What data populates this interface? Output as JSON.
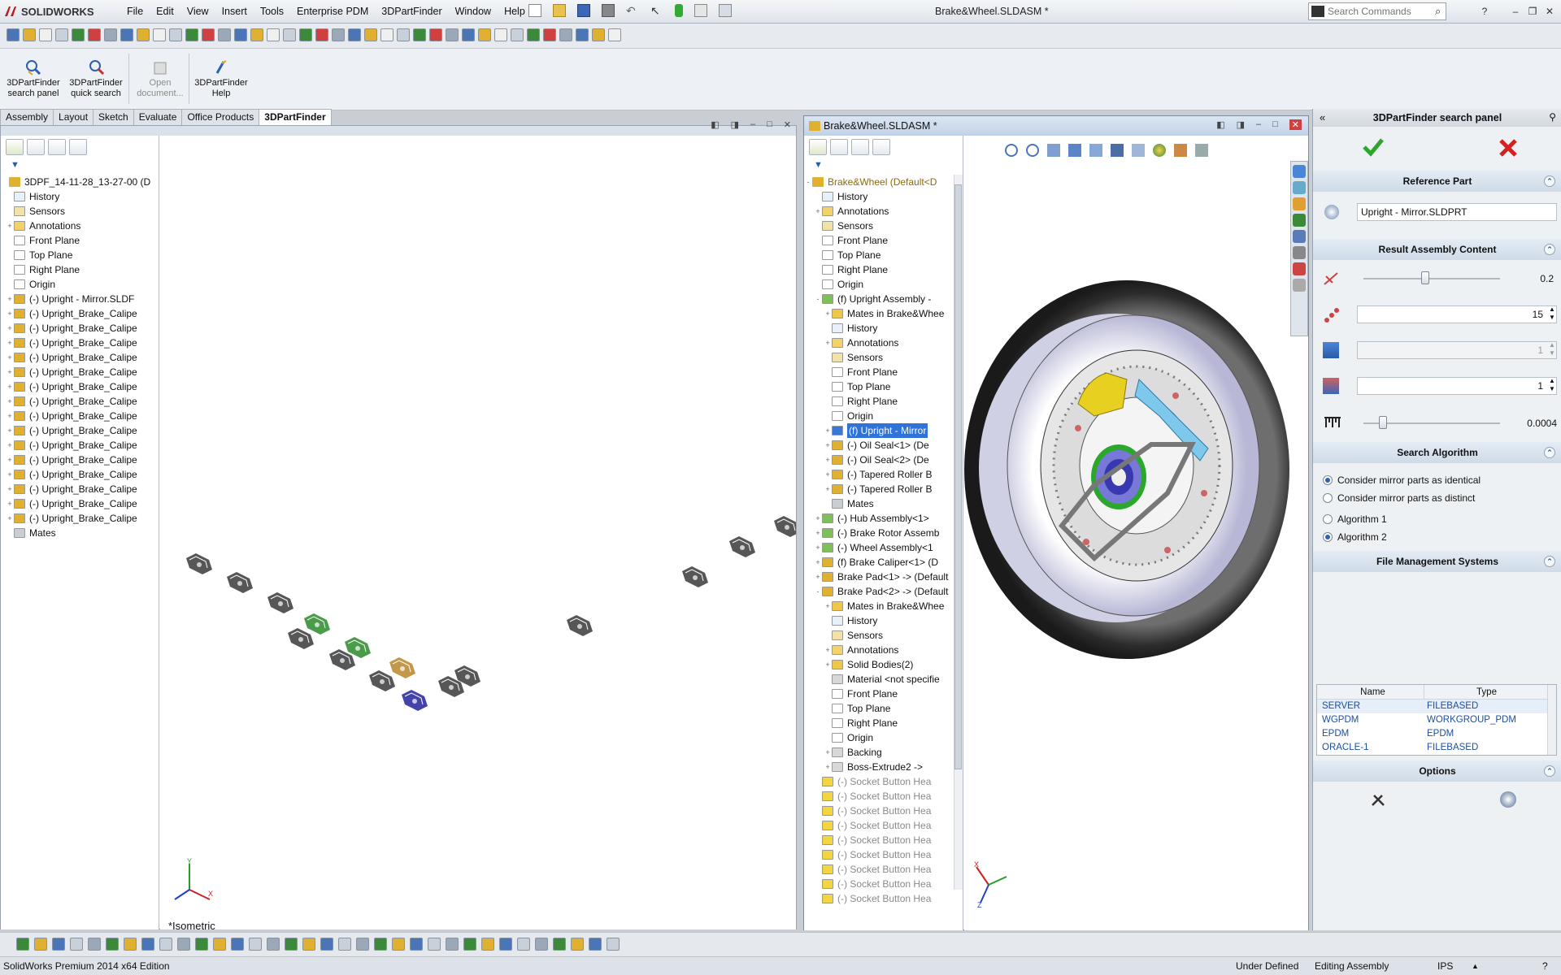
{
  "app": {
    "brand": "SOLIDWORKS",
    "document_title": "Brake&Wheel.SLDASM *",
    "menus": [
      "File",
      "Edit",
      "View",
      "Insert",
      "Tools",
      "Enterprise PDM",
      "3DPartFinder",
      "Window",
      "Help"
    ],
    "search_placeholder": "Search Commands"
  },
  "ribbon": {
    "buttons": [
      {
        "label": "3DPartFinder search panel",
        "enabled": true
      },
      {
        "label": "3DPartFinder quick search",
        "enabled": true
      },
      {
        "label": "Open document...",
        "enabled": false
      },
      {
        "label": "3DPartFinder Help",
        "enabled": true
      }
    ]
  },
  "command_tabs": [
    "Assembly",
    "Layout",
    "Sketch",
    "Evaluate",
    "Office Products",
    "3DPartFinder"
  ],
  "command_tabs_active": "3DPartFinder",
  "left_window": {
    "tree_root": "3DPF_14-11-28_13-27-00  (D",
    "tree_items": [
      {
        "label": "History",
        "type": "history"
      },
      {
        "label": "Sensors",
        "type": "sensor"
      },
      {
        "label": "Annotations",
        "type": "annot",
        "exp": "+"
      },
      {
        "label": "Front Plane",
        "type": "plane"
      },
      {
        "label": "Top Plane",
        "type": "plane"
      },
      {
        "label": "Right Plane",
        "type": "plane"
      },
      {
        "label": "Origin",
        "type": "origin"
      },
      {
        "label": "(-) Upright - Mirror.SLDF",
        "type": "part",
        "exp": "+"
      },
      {
        "label": "(-) Upright_Brake_Calipe",
        "type": "part",
        "exp": "+"
      },
      {
        "label": "(-) Upright_Brake_Calipe",
        "type": "part",
        "exp": "+"
      },
      {
        "label": "(-) Upright_Brake_Calipe",
        "type": "part",
        "exp": "+"
      },
      {
        "label": "(-) Upright_Brake_Calipe",
        "type": "part",
        "exp": "+"
      },
      {
        "label": "(-) Upright_Brake_Calipe",
        "type": "part",
        "exp": "+"
      },
      {
        "label": "(-) Upright_Brake_Calipe",
        "type": "part",
        "exp": "+"
      },
      {
        "label": "(-) Upright_Brake_Calipe",
        "type": "part",
        "exp": "+"
      },
      {
        "label": "(-) Upright_Brake_Calipe",
        "type": "part",
        "exp": "+"
      },
      {
        "label": "(-) Upright_Brake_Calipe",
        "type": "part",
        "exp": "+"
      },
      {
        "label": "(-) Upright_Brake_Calipe",
        "type": "part",
        "exp": "+"
      },
      {
        "label": "(-) Upright_Brake_Calipe",
        "type": "part",
        "exp": "+"
      },
      {
        "label": "(-) Upright_Brake_Calipe",
        "type": "part",
        "exp": "+"
      },
      {
        "label": "(-) Upright_Brake_Calipe",
        "type": "part",
        "exp": "+"
      },
      {
        "label": "(-) Upright_Brake_Calipe",
        "type": "part",
        "exp": "+"
      },
      {
        "label": "(-) Upright_Brake_Calipe",
        "type": "part",
        "exp": "+"
      },
      {
        "label": "Mates",
        "type": "mates"
      }
    ],
    "view_name": "*Isometric"
  },
  "right_window": {
    "title": "Brake&Wheel.SLDASM *",
    "tree_root": "Brake&Wheel  (Default<D",
    "tree_items": [
      {
        "label": "History",
        "type": "history",
        "indent": 1
      },
      {
        "label": "Annotations",
        "type": "annot",
        "indent": 1,
        "exp": "+"
      },
      {
        "label": "Sensors",
        "type": "sensor",
        "indent": 1
      },
      {
        "label": "Front Plane",
        "type": "plane",
        "indent": 1
      },
      {
        "label": "Top Plane",
        "type": "plane",
        "indent": 1
      },
      {
        "label": "Right Plane",
        "type": "plane",
        "indent": 1
      },
      {
        "label": "Origin",
        "type": "origin",
        "indent": 1
      },
      {
        "label": "(f) Upright Assembly -",
        "type": "asm",
        "indent": 1,
        "exp": "-"
      },
      {
        "label": "Mates in Brake&Whee",
        "type": "folder",
        "indent": 2,
        "exp": "+"
      },
      {
        "label": "History",
        "type": "history",
        "indent": 2
      },
      {
        "label": "Annotations",
        "type": "annot",
        "indent": 2,
        "exp": "+"
      },
      {
        "label": "Sensors",
        "type": "sensor",
        "indent": 2
      },
      {
        "label": "Front Plane",
        "type": "plane",
        "indent": 2
      },
      {
        "label": "Top Plane",
        "type": "plane",
        "indent": 2
      },
      {
        "label": "Right Plane",
        "type": "plane",
        "indent": 2
      },
      {
        "label": "Origin",
        "type": "origin",
        "indent": 2
      },
      {
        "label": "(f) Upright - Mirror",
        "type": "partsel",
        "indent": 2,
        "exp": "+",
        "selected": true
      },
      {
        "label": "(-) Oil Seal<1> (De",
        "type": "part",
        "indent": 2,
        "exp": "+"
      },
      {
        "label": "(-) Oil Seal<2> (De",
        "type": "part",
        "indent": 2,
        "exp": "+"
      },
      {
        "label": "(-) Tapered Roller B",
        "type": "part",
        "indent": 2,
        "exp": "+"
      },
      {
        "label": "(-) Tapered Roller B",
        "type": "part",
        "indent": 2,
        "exp": "+"
      },
      {
        "label": "Mates",
        "type": "mates",
        "indent": 2
      },
      {
        "label": "(-) Hub Assembly<1>",
        "type": "asm",
        "indent": 1,
        "exp": "+"
      },
      {
        "label": "(-) Brake Rotor Assemb",
        "type": "asm",
        "indent": 1,
        "exp": "+"
      },
      {
        "label": "(-) Wheel Assembly<1",
        "type": "asm",
        "indent": 1,
        "exp": "+"
      },
      {
        "label": "(f) Brake Caliper<1> (D",
        "type": "part",
        "indent": 1,
        "exp": "+"
      },
      {
        "label": "Brake Pad<1> -> (Default",
        "type": "part",
        "indent": 1,
        "exp": "+"
      },
      {
        "label": "Brake Pad<2> -> (Default",
        "type": "part",
        "indent": 1,
        "exp": "-"
      },
      {
        "label": "Mates in Brake&Whee",
        "type": "folder",
        "indent": 2,
        "exp": "+"
      },
      {
        "label": "History",
        "type": "history",
        "indent": 2
      },
      {
        "label": "Sensors",
        "type": "sensor",
        "indent": 2
      },
      {
        "label": "Annotations",
        "type": "annot",
        "indent": 2,
        "exp": "+"
      },
      {
        "label": "Solid Bodies(2)",
        "type": "folder",
        "indent": 2,
        "exp": "+"
      },
      {
        "label": "Material <not specifie",
        "type": "material",
        "indent": 2
      },
      {
        "label": "Front Plane",
        "type": "plane",
        "indent": 2
      },
      {
        "label": "Top Plane",
        "type": "plane",
        "indent": 2
      },
      {
        "label": "Right Plane",
        "type": "plane",
        "indent": 2
      },
      {
        "label": "Origin",
        "type": "origin",
        "indent": 2
      },
      {
        "label": "Backing",
        "type": "feature",
        "indent": 2,
        "exp": "+"
      },
      {
        "label": "Boss-Extrude2 ->",
        "type": "feature",
        "indent": 2,
        "exp": "+"
      },
      {
        "label": "(-) Socket Button Hea",
        "type": "warn",
        "indent": 1,
        "gray": true
      },
      {
        "label": "(-) Socket Button Hea",
        "type": "warn",
        "indent": 1,
        "gray": true
      },
      {
        "label": "(-) Socket Button Hea",
        "type": "warn",
        "indent": 1,
        "gray": true
      },
      {
        "label": "(-) Socket Button Hea",
        "type": "warn",
        "indent": 1,
        "gray": true
      },
      {
        "label": "(-) Socket Button Hea",
        "type": "warn",
        "indent": 1,
        "gray": true
      },
      {
        "label": "(-) Socket Button Hea",
        "type": "warn",
        "indent": 1,
        "gray": true
      },
      {
        "label": "(-) Socket Button Hea",
        "type": "warn",
        "indent": 1,
        "gray": true
      },
      {
        "label": "(-) Socket Button Hea",
        "type": "warn",
        "indent": 1,
        "gray": true
      },
      {
        "label": "(-) Socket Button Hea",
        "type": "warn",
        "indent": 1,
        "gray": true
      }
    ]
  },
  "panel": {
    "title": "3DPartFinder search panel",
    "reference_part_header": "Reference Part",
    "reference_part_value": "Upright - Mirror.SLDPRT",
    "result_header": "Result Assembly Content",
    "slider1_value": "0.2",
    "slider1_fraction": 0.45,
    "count_value": "15",
    "spin2_value": "1",
    "spin3_value": "1",
    "slider2_value": "0.0004",
    "slider2_fraction": 0.14,
    "algorithm_header": "Search Algorithm",
    "radios": [
      {
        "label": "Consider mirror parts as identical",
        "on": true
      },
      {
        "label": "Consider mirror parts as distinct",
        "on": false
      },
      {
        "label": "Algorithm 1",
        "on": false
      },
      {
        "label": "Algorithm 2",
        "on": true
      }
    ],
    "fms_header": "File Management Systems",
    "fms_columns": [
      "Name",
      "Type"
    ],
    "fms_rows": [
      {
        "name": "SERVER",
        "type": "FILEBASED"
      },
      {
        "name": "WGPDM",
        "type": "WORKGROUP_PDM"
      },
      {
        "name": "EPDM",
        "type": "EPDM"
      },
      {
        "name": "ORACLE-1",
        "type": "FILEBASED"
      }
    ],
    "options_header": "Options"
  },
  "status": {
    "edition": "SolidWorks Premium 2014 x64 Edition",
    "state": "Under Defined",
    "mode": "Editing Assembly",
    "units": "IPS"
  },
  "colors": {
    "accent": "#2f73d8",
    "ok_green": "#2fa52f",
    "cancel_red": "#d62020"
  }
}
